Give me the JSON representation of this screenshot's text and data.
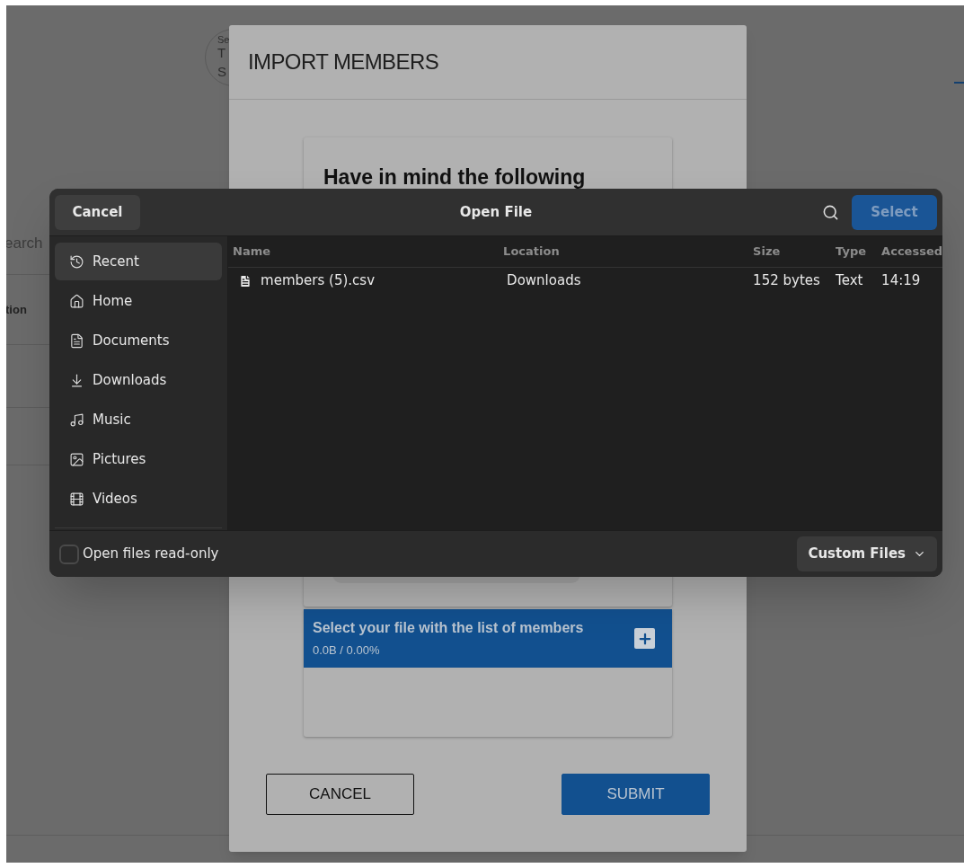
{
  "background": {
    "avatar_lines": [
      "Se",
      "T",
      "S"
    ],
    "search_placeholder": "earch",
    "column_label": "tion"
  },
  "modal": {
    "title": "IMPORT MEMBERS",
    "notice_heading": "Have in mind the following",
    "upload": {
      "label": "Select your file with the list of members",
      "progress": "0.0B / 0.00%"
    },
    "buttons": [
      {
        "label": "CANCEL",
        "kind": "outline"
      },
      {
        "label": "SUBMIT",
        "kind": "primary"
      }
    ]
  },
  "file_dialog": {
    "title": "Open File",
    "cancel": "Cancel",
    "select": {
      "label": "Select",
      "disabled": true
    },
    "places": [
      {
        "label": "Recent",
        "kind": "recent",
        "selected": true
      },
      {
        "label": "Home",
        "kind": "home",
        "selected": false
      },
      {
        "label": "Documents",
        "kind": "documents",
        "selected": false
      },
      {
        "label": "Downloads",
        "kind": "downloads",
        "selected": false
      },
      {
        "label": "Music",
        "kind": "music",
        "selected": false
      },
      {
        "label": "Pictures",
        "kind": "pictures",
        "selected": false
      },
      {
        "label": "Videos",
        "kind": "videos",
        "selected": false
      }
    ],
    "columns": [
      "Name",
      "Location",
      "Size",
      "Type",
      "Accessed"
    ],
    "files": [
      {
        "name": "members (5).csv",
        "location": "Downloads",
        "size": "152 bytes",
        "type": "Text",
        "accessed": "14:19"
      }
    ],
    "read_only": {
      "label": "Open files read-only",
      "checked": false
    },
    "filter": "Custom Files"
  }
}
